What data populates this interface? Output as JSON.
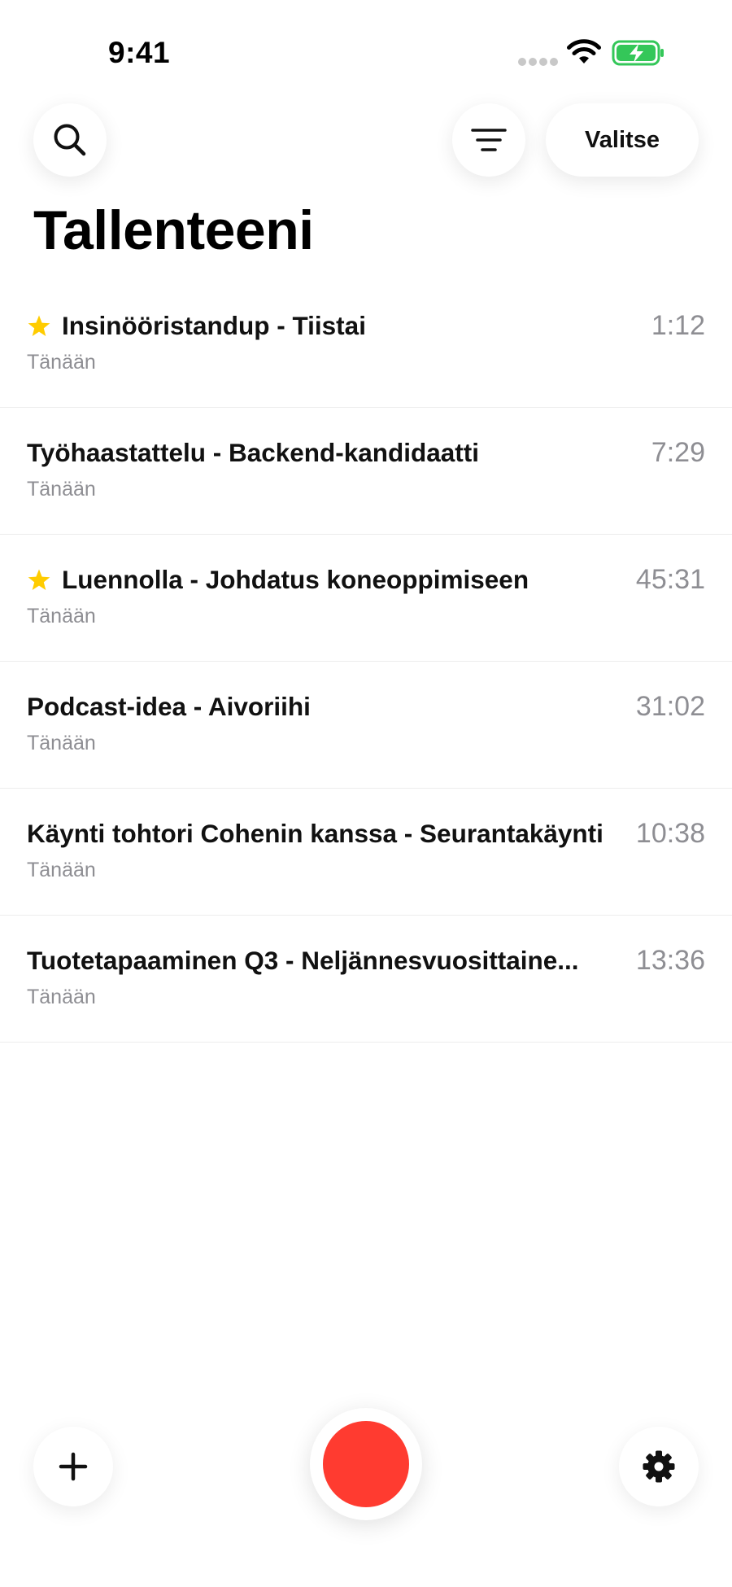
{
  "status_bar": {
    "time": "9:41"
  },
  "header": {
    "search_icon": "search-icon",
    "sort_icon": "filter-lines-icon",
    "select_label": "Valitse"
  },
  "page_title": "Tallenteeni",
  "recordings": [
    {
      "title": "Insinööristandup - Tiistai",
      "date": "Tänään",
      "duration": "1:12",
      "starred": true
    },
    {
      "title": "Työhaastattelu - Backend-kandidaatti",
      "date": "Tänään",
      "duration": "7:29",
      "starred": false
    },
    {
      "title": "Luennolla - Johdatus koneoppimiseen",
      "date": "Tänään",
      "duration": "45:31",
      "starred": true
    },
    {
      "title": "Podcast-idea - Aivoriihi",
      "date": "Tänään",
      "duration": "31:02",
      "starred": false
    },
    {
      "title": "Käynti tohtori Cohenin kanssa - Seurantakäynti",
      "date": "Tänään",
      "duration": "10:38",
      "starred": false
    },
    {
      "title": "Tuotetapaaminen Q3 - Neljännesvuosittaine...",
      "date": "Tänään",
      "duration": "13:36",
      "starred": false
    }
  ],
  "bottom_bar": {
    "add_icon": "plus-icon",
    "record_icon": "record-icon",
    "settings_icon": "gear-icon"
  },
  "colors": {
    "record": "#ff3b30",
    "star": "#ffcc00",
    "battery_charging": "#34c759",
    "secondary_text": "#8e8e93"
  }
}
